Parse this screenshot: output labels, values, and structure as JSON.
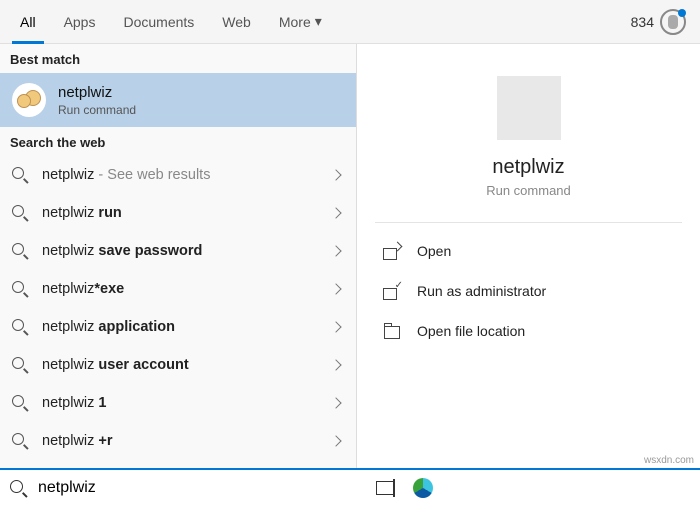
{
  "tabs": [
    "All",
    "Apps",
    "Documents",
    "Web",
    "More"
  ],
  "active_tab": 0,
  "points": "834",
  "sections": {
    "best_match_label": "Best match",
    "search_web_label": "Search the web"
  },
  "best_match": {
    "title": "netplwiz",
    "subtitle": "Run command"
  },
  "web_results": [
    {
      "prefix": "netplwiz",
      "bold": "",
      "suffix": " - See web results"
    },
    {
      "prefix": "netplwiz ",
      "bold": "run",
      "suffix": ""
    },
    {
      "prefix": "netplwiz ",
      "bold": "save password",
      "suffix": ""
    },
    {
      "prefix": "netplwiz",
      "bold": "*exe",
      "suffix": ""
    },
    {
      "prefix": "netplwiz ",
      "bold": "application",
      "suffix": ""
    },
    {
      "prefix": "netplwiz ",
      "bold": "user account",
      "suffix": ""
    },
    {
      "prefix": "netplwiz ",
      "bold": "1",
      "suffix": ""
    },
    {
      "prefix": "netplwiz ",
      "bold": "+r",
      "suffix": ""
    }
  ],
  "detail": {
    "title": "netplwiz",
    "subtitle": "Run command",
    "actions": [
      "Open",
      "Run as administrator",
      "Open file location"
    ]
  },
  "search_value": "netplwiz",
  "watermark": "wsxdn.com"
}
